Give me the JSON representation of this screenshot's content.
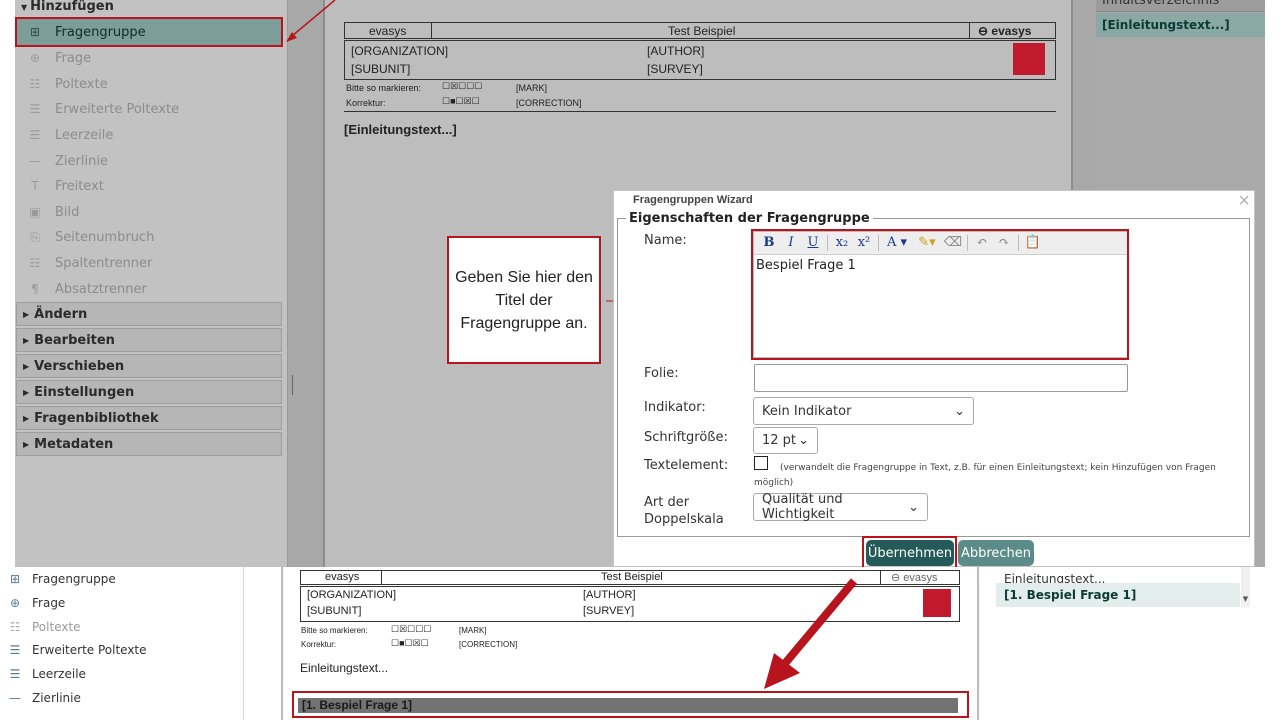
{
  "top": {
    "sidebar": {
      "header": "Hinzufügen",
      "items": [
        {
          "label": "Fragengruppe",
          "icon": "plus-square-icon",
          "active": true
        },
        {
          "label": "Frage",
          "icon": "question-bubble-icon"
        },
        {
          "label": "Poltexte",
          "icon": "poltext-icon"
        },
        {
          "label": "Erweiterte Poltexte",
          "icon": "extended-poltext-icon"
        },
        {
          "label": "Leerzeile",
          "icon": "blank-line-icon"
        },
        {
          "label": "Zierlinie",
          "icon": "divider-line-icon"
        },
        {
          "label": "Freitext",
          "icon": "text-icon"
        },
        {
          "label": "Bild",
          "icon": "image-icon"
        },
        {
          "label": "Seitenumbruch",
          "icon": "page-break-icon"
        },
        {
          "label": "Spaltentrenner",
          "icon": "column-separator-icon"
        },
        {
          "label": "Absatztrenner",
          "icon": "pilcrow-icon"
        }
      ],
      "sections": [
        "Ändern",
        "Bearbeiten",
        "Verschieben",
        "Einstellungen",
        "Fragenbibliothek",
        "Metadaten"
      ]
    },
    "document": {
      "brand": "evasys",
      "title": "Test Beispiel",
      "logo_text": "evasys",
      "organization": "[ORGANIZATION]",
      "author": "[AUTHOR]",
      "subunit": "[SUBUNIT]",
      "survey": "[SURVEY]",
      "mark_label": "Bitte so markieren:",
      "mark_tag": "[MARK]",
      "correction_label": "Korrektur:",
      "correction_tag": "[CORRECTION]",
      "intro": "[Einleitungstext...]"
    },
    "right_panel": {
      "header": "Inhaltsverzeichnis",
      "item": "[Einleitungstext...]"
    },
    "callout": "Geben Sie hier den Titel der Fragengruppe an.",
    "dialog": {
      "title": "Fragengruppen Wizard",
      "legend": "Eigenschaften der Fragengruppe",
      "name_label": "Name:",
      "name_value": "Bespiel Frage 1",
      "folie_label": "Folie:",
      "indikator_label": "Indikator:",
      "indikator_value": "Kein Indikator",
      "schrift_label": "Schriftgröße:",
      "schrift_value": "12 pt",
      "textelement_label": "Textelement:",
      "textelement_note": "(verwandelt die Fragengruppe in Text, z.B. für einen Einleitungstext; kein Hinzufügen von Fragen möglich)",
      "doppelskala_label_1": "Art der",
      "doppelskala_label_2": "Doppelskala",
      "doppelskala_value": "Qualität und Wichtigkeit",
      "apply_button": "Übernehmen",
      "cancel_button": "Abbrechen",
      "close_glyph": "×"
    }
  },
  "bottom": {
    "sidebar": [
      {
        "label": "Fragengruppe",
        "icon": "plus-square-icon"
      },
      {
        "label": "Frage",
        "icon": "question-bubble-icon"
      },
      {
        "label": "Poltexte",
        "icon": "poltext-icon",
        "muted": true
      },
      {
        "label": "Erweiterte Poltexte",
        "icon": "extended-poltext-icon"
      },
      {
        "label": "Leerzeile",
        "icon": "blank-line-icon"
      },
      {
        "label": "Zierlinie",
        "icon": "divider-line-icon"
      }
    ],
    "document": {
      "brand": "evasys",
      "title": "Test Beispiel",
      "logo_text": "evasys",
      "organization": "[ORGANIZATION]",
      "author": "[AUTHOR]",
      "subunit": "[SUBUNIT]",
      "survey": "[SURVEY]",
      "mark_label": "Bitte so markieren:",
      "mark_tag": "[MARK]",
      "correction_label": "Korrektur:",
      "correction_tag": "[CORRECTION]",
      "intro": "Einleitungstext...",
      "new_group": "[1. Bespiel Frage 1]"
    },
    "right_panel": {
      "item_1": "Einleitungstext...",
      "item_2": "[1. Bespiel Frage 1]"
    }
  },
  "colors": {
    "highlight": "#b8141d",
    "primary_button": "#245b58",
    "secondary_button": "#5c8c89",
    "active_item": "#7d9d9a"
  }
}
